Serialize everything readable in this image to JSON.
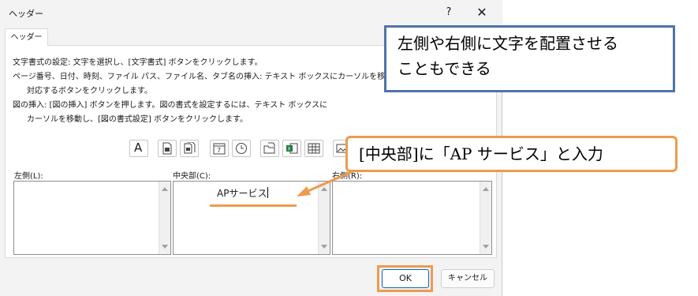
{
  "window": {
    "title": "ヘッダー",
    "help_glyph": "?",
    "close_glyph": "✕"
  },
  "tab": {
    "label": "ヘッダー"
  },
  "instructions": [
    "文字書式の設定: 文字を選択し、[文字書式] ボタンをクリックします。",
    "ページ番号、日付、時刻、ファイル パス、ファイル名、タブ名の挿入: テキスト ボックスにカーソルを移動し、",
    "対応するボタンをクリックします。",
    "図の挿入: [図の挿入] ボタンを押します。図の書式を設定するには、テキスト ボックスに",
    "カーソルを移動し、[図の書式設定] ボタンをクリックします。"
  ],
  "toolbar": {
    "icons": [
      "format-text-icon",
      "page-number-icon",
      "number-of-pages-icon",
      "date-icon",
      "time-icon",
      "file-path-icon",
      "file-name-icon",
      "sheet-name-icon",
      "insert-picture-icon"
    ],
    "format_text_glyph": "A"
  },
  "sections": {
    "left": {
      "label": "左側(L):",
      "value": ""
    },
    "center": {
      "label": "中央部(C):",
      "value": "APサービス"
    },
    "right": {
      "label": "右側(R):",
      "value": ""
    }
  },
  "buttons": {
    "ok": "OK",
    "cancel": "キャンセル"
  },
  "annotations": {
    "callout_blue_line1": "左側や右側に文字を配置させる",
    "callout_blue_line2": "こともできる",
    "callout_orange": "[中央部]に「AP サービス」と入力"
  },
  "colors": {
    "annotation_orange": "#ed9b4d",
    "annotation_blue": "#4f74a8",
    "ok_border": "#0067c0"
  }
}
